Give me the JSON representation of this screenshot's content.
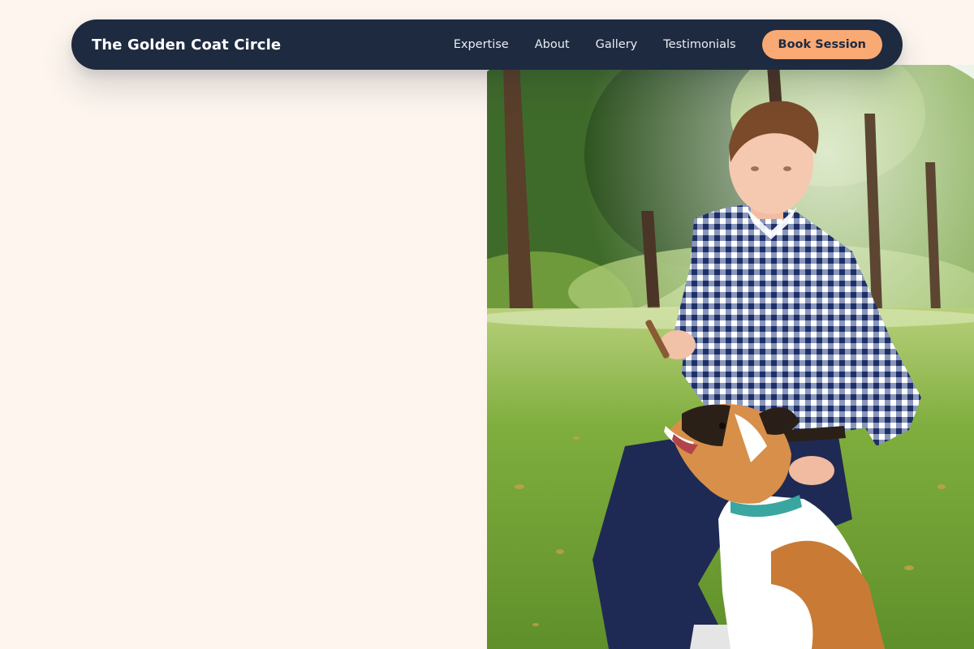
{
  "brand": {
    "name": "The Golden Coat Circle"
  },
  "nav": {
    "links": [
      "Expertise",
      "About",
      "Gallery",
      "Testimonials"
    ],
    "cta_label": "Book Session"
  },
  "hero": {
    "photo_description_icon": "man-training-dog-photo"
  },
  "colors": {
    "page_background": "#fdf5ee",
    "navbar_background": "#1e2a3f",
    "cta_background": "#f9a974",
    "cta_text": "#1e2a3f"
  }
}
